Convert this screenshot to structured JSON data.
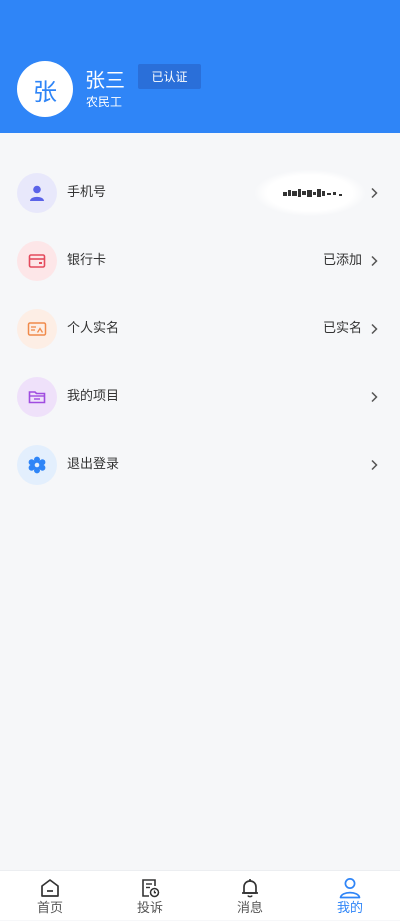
{
  "profile": {
    "avatar_char": "张",
    "name": "张三",
    "role": "农民工",
    "badge": "已认证"
  },
  "menu": [
    {
      "label": "手机号",
      "value": "",
      "icon": "user-icon",
      "icon_color": "#5b63e8",
      "icon_bg": "#e8e8fb"
    },
    {
      "label": "银行卡",
      "value": "已添加",
      "icon": "wallet-icon",
      "icon_color": "#e44a5c",
      "icon_bg": "#fde6e8"
    },
    {
      "label": "个人实名",
      "value": "已实名",
      "icon": "id-card-icon",
      "icon_color": "#f08a4b",
      "icon_bg": "#fdeee5"
    },
    {
      "label": "我的项目",
      "value": "",
      "icon": "folder-icon",
      "icon_color": "#a04ce0",
      "icon_bg": "#efe1fa"
    },
    {
      "label": "退出登录",
      "value": "",
      "icon": "settings-icon",
      "icon_color": "#2f85f7",
      "icon_bg": "#e3effd"
    }
  ],
  "tabs": [
    {
      "label": "首页",
      "icon": "home-icon",
      "active": false
    },
    {
      "label": "投诉",
      "icon": "complaint-icon",
      "active": false
    },
    {
      "label": "消息",
      "icon": "bell-icon",
      "active": false
    },
    {
      "label": "我的",
      "icon": "user-icon",
      "active": true
    }
  ],
  "colors": {
    "primary": "#2f85f7",
    "background": "#f6f7f9"
  }
}
